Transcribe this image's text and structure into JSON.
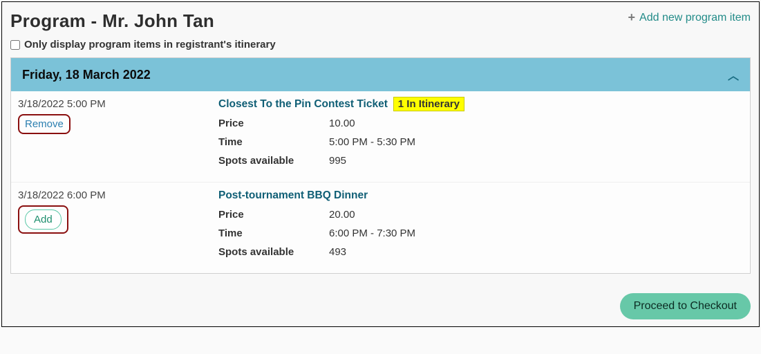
{
  "header": {
    "title": "Program - Mr. John Tan",
    "add_new_label": "Add new program item"
  },
  "filter": {
    "only_itinerary_label": "Only display program items in registrant's itinerary",
    "checked": false
  },
  "day": {
    "title": "Friday, 18 March 2022"
  },
  "items": [
    {
      "datetime": "3/18/2022 5:00 PM",
      "action_label": "Remove",
      "action_type": "remove",
      "title": "Closest To the Pin Contest Ticket",
      "badge": "1 In Itinerary",
      "price_label": "Price",
      "price": "10.00",
      "time_label": "Time",
      "time": "5:00 PM - 5:30 PM",
      "spots_label": "Spots available",
      "spots": "995"
    },
    {
      "datetime": "3/18/2022 6:00 PM",
      "action_label": "Add",
      "action_type": "add",
      "title": "Post-tournament BBQ Dinner",
      "badge": "",
      "price_label": "Price",
      "price": "20.00",
      "time_label": "Time",
      "time": "6:00 PM - 7:30 PM",
      "spots_label": "Spots available",
      "spots": "493"
    }
  ],
  "footer": {
    "checkout_label": "Proceed to Checkout"
  }
}
